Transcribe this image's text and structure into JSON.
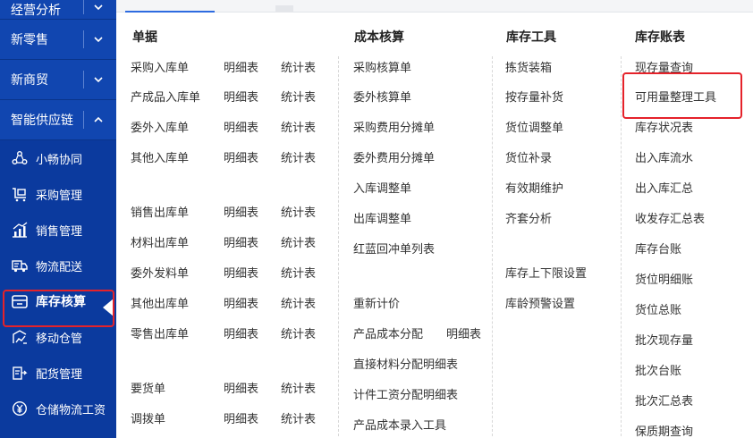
{
  "sidebar": {
    "top_items": [
      {
        "label": "经营分析",
        "chevron": "down"
      },
      {
        "label": "新零售",
        "chevron": "down"
      },
      {
        "label": "新商贸",
        "chevron": "down"
      },
      {
        "label": "智能供应链",
        "chevron": "up"
      }
    ],
    "sub_items": [
      {
        "label": "小畅协同",
        "icon": "collaboration-icon"
      },
      {
        "label": "采购管理",
        "icon": "cart-icon"
      },
      {
        "label": "销售管理",
        "icon": "chart-icon"
      },
      {
        "label": "物流配送",
        "icon": "truck-icon"
      },
      {
        "label": "库存核算",
        "icon": "inventory-icon"
      },
      {
        "label": "移动仓管",
        "icon": "mobile-warehouse-icon"
      },
      {
        "label": "配货管理",
        "icon": "distribution-icon"
      },
      {
        "label": "仓储物流工资",
        "icon": "yen-icon"
      }
    ]
  },
  "panel": {
    "headers": {
      "documents": "单据",
      "costing": "成本核算",
      "tools": "库存工具",
      "ledger": "库存账表"
    },
    "documents": [
      {
        "name": "采购入库单",
        "detail": "明细表",
        "stats": "统计表"
      },
      {
        "name": "产成品入库单",
        "detail": "明细表",
        "stats": "统计表"
      },
      {
        "name": "委外入库单",
        "detail": "明细表",
        "stats": "统计表"
      },
      {
        "name": "其他入库单",
        "detail": "明细表",
        "stats": "统计表"
      },
      {
        "name": "销售出库单",
        "detail": "明细表",
        "stats": "统计表"
      },
      {
        "name": "材料出库单",
        "detail": "明细表",
        "stats": "统计表"
      },
      {
        "name": "委外发料单",
        "detail": "明细表",
        "stats": "统计表"
      },
      {
        "name": "其他出库单",
        "detail": "明细表",
        "stats": "统计表"
      },
      {
        "name": "零售出库单",
        "detail": "明细表",
        "stats": "统计表"
      },
      {
        "name": "要货单",
        "detail": "明细表",
        "stats": "统计表"
      },
      {
        "name": "调拨单",
        "detail": "明细表",
        "stats": "统计表"
      }
    ],
    "costing": [
      "采购核算单",
      "委外核算单",
      "采购费用分摊单",
      "委外费用分摊单",
      "入库调整单",
      "出库调整单",
      "红蓝回冲单列表",
      "重新计价",
      "产品成本分配",
      "明细表",
      "直接材料分配明细表",
      "计件工资分配明细表",
      "产品成本录入工具"
    ],
    "tools": [
      "拣货装箱",
      "按存量补货",
      "货位调整单",
      "货位补录",
      "有效期维护",
      "齐套分析",
      "库存上下限设置",
      "库龄预警设置"
    ],
    "ledger": [
      "现存量查询",
      "可用量整理工具",
      "库存状况表",
      "出入库流水",
      "出入库汇总",
      "收发存汇总表",
      "库存台账",
      "货位明细账",
      "货位总账",
      "批次现存量",
      "批次台账",
      "批次汇总表",
      "保质期查询"
    ]
  },
  "colors": {
    "sidebar_bg": "#0b3a9e",
    "highlight": "#e5222a",
    "accent": "#2d6be0"
  }
}
